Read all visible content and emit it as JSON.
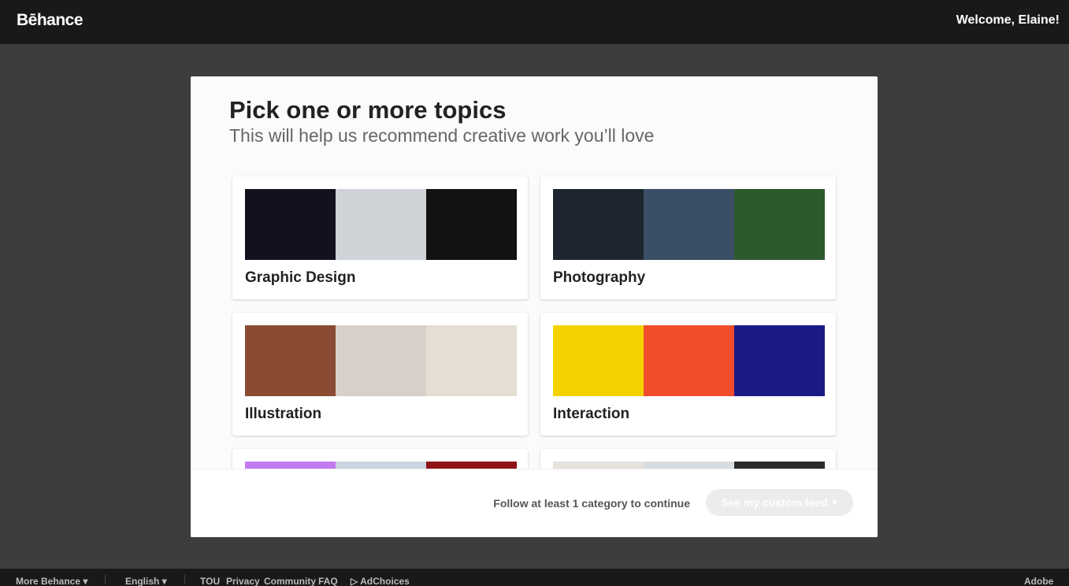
{
  "header": {
    "logo": "Bēhance",
    "welcome": "Welcome, Elaine!"
  },
  "modal": {
    "title": "Pick one or more topics",
    "subtitle": "This will help us recommend creative work you’ll love",
    "cards": [
      {
        "label": "Graphic Design",
        "thumbs": [
          "#14101f",
          "#cfd3d8",
          "#121212"
        ]
      },
      {
        "label": "Photography",
        "thumbs": [
          "#1d2630",
          "#3a4e66",
          "#2c5a2c"
        ]
      },
      {
        "label": "Illustration",
        "thumbs": [
          "#8a4b32",
          "#d6d0c8",
          "#e4ded3"
        ]
      },
      {
        "label": "Interaction",
        "thumbs": [
          "#f2d300",
          "#f04d2c",
          "#1a1a86"
        ]
      },
      {
        "label": "",
        "thumbs": [
          "#c27cf0",
          "#c9d4e0",
          "#8e1515"
        ]
      },
      {
        "label": "",
        "thumbs": [
          "#e6e2de",
          "#d8dde2",
          "#2b2b2b"
        ]
      }
    ],
    "footer": {
      "message": "Follow at least 1 category to continue",
      "cta": "See my custom feed",
      "cta_arrow": "▸"
    }
  },
  "footer": {
    "more": "More Behance ▾",
    "language": "English ▾",
    "links": [
      "TOU",
      "Privacy",
      "Community",
      "FAQ"
    ],
    "adchoices": "▷ AdChoices",
    "adobe": "Adobe"
  }
}
